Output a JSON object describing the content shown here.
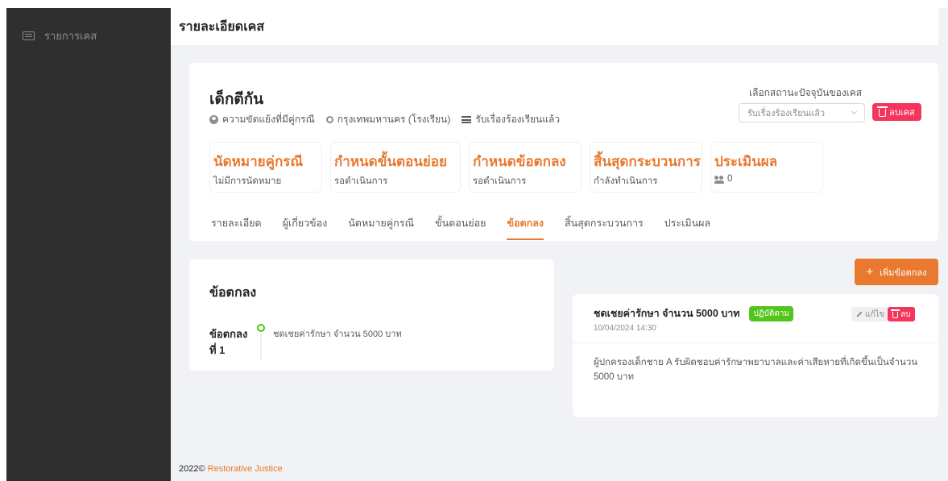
{
  "sidebar": {
    "items": [
      {
        "label": "รายการเคส",
        "icon": "list-icon"
      }
    ]
  },
  "header": {
    "title": "รายละเอียดเคส"
  },
  "case": {
    "title": "เด็กตีกัน",
    "meta": {
      "type": "ความขัดแย้งที่มีคู่กรณี",
      "location": "กรุงเทพมหานคร (โรงเรียน)",
      "status": "รับเรื่องร้องเรียนแล้ว"
    },
    "status_label": "เลือกสถานะปัจจุบันของเคส",
    "status_value": "รับเรื่องร้องเรียนแล้ว",
    "delete_label": "ลบเคส"
  },
  "stats": [
    {
      "title": "นัดหมายคู่กรณี",
      "sub": "ไม่มีการนัดหมาย"
    },
    {
      "title": "กำหนดขั้นตอนย่อย",
      "sub": "รอดำเนินการ"
    },
    {
      "title": "กำหนดข้อตกลง",
      "sub": "รอดำเนินการ"
    },
    {
      "title": "สิ้นสุดกระบวนการ",
      "sub": "กำลังทำเนินการ"
    },
    {
      "title": "ประเมินผล",
      "sub": "0"
    }
  ],
  "tabs": [
    {
      "label": "รายละเอียด"
    },
    {
      "label": "ผู้เกี่ยวข้อง"
    },
    {
      "label": "นัดหมายคู่กรณี"
    },
    {
      "label": "ขั้นตอนย่อย"
    },
    {
      "label": "ข้อตกลง"
    },
    {
      "label": "สิ้นสุดกระบวนการ"
    },
    {
      "label": "ประเมินผล"
    }
  ],
  "active_tab": "ข้อตกลง",
  "agreements": {
    "title": "ข้อตกลง",
    "items": [
      {
        "number_label": "ข้อตกลงที่ 1",
        "text": "ชดเชยค่ารักษา จำนวน 5000 บาท"
      }
    ]
  },
  "add_button": {
    "label": "เพิ่มข้อตกลง"
  },
  "detail": {
    "title": "ชดเชยค่ารักษา จำนวน 5000 บาท",
    "badge": "ปฏิบัติตาม",
    "date": "10/04/2024 14:30",
    "edit_label": "แก้ไข",
    "delete_label": "ลบ",
    "body": "ผู้ปกครองเด็กชาย A รับผิดชอบค่ารักษาพยาบาลและค่าเสียหายที่เกิดขึ้นเป็นจำนวน 5000 บาท"
  },
  "footer": {
    "prefix": "2022© ",
    "brand": "Restorative Justice"
  },
  "colors": {
    "accent": "#e8792f",
    "danger": "#f5365c",
    "success": "#52c41a",
    "sidebar": "#2f2f2f",
    "background": "#f0f2f5"
  }
}
